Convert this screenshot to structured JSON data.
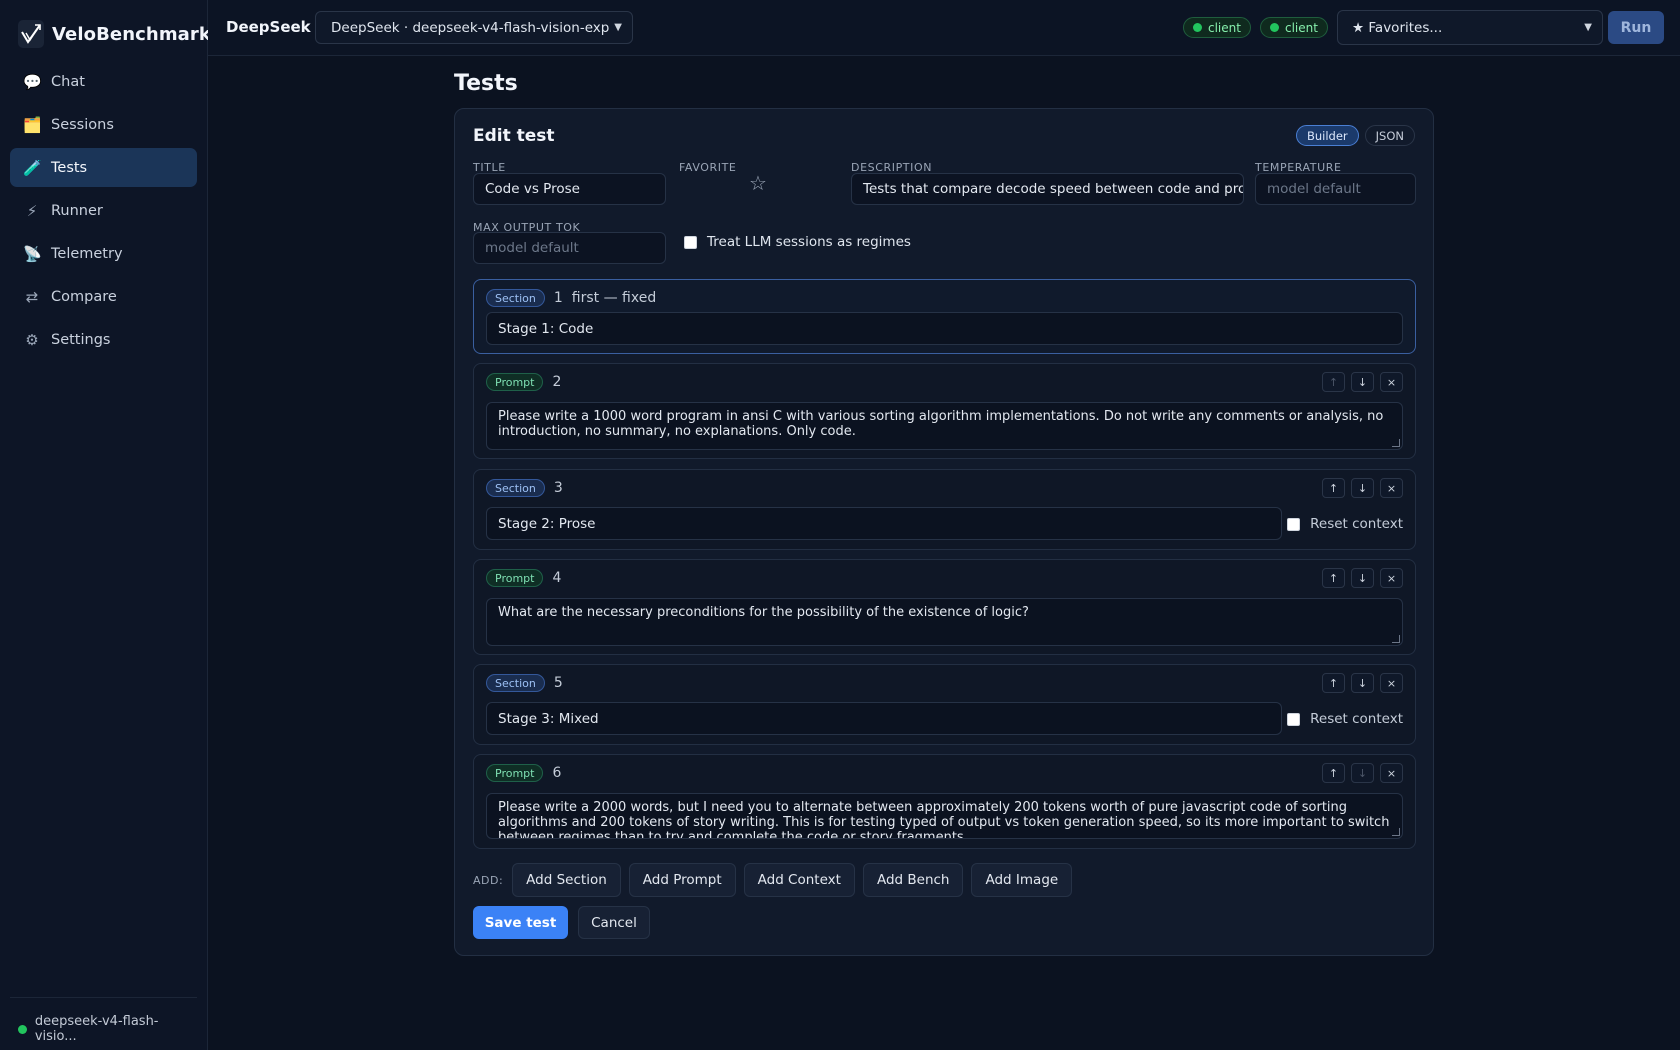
{
  "app": {
    "brand": "VeloBenchmark",
    "provider": "DeepSeek",
    "model_select": "DeepSeek · deepseek-v4-flash-vision-exp",
    "status_pills": [
      "client",
      "client"
    ],
    "favorites_select": "★ Favorites...",
    "run_label": "Run",
    "footer_model": "deepseek-v4-flash-visio..."
  },
  "sidebar": {
    "items": [
      {
        "label": "Chat",
        "icon": "💬"
      },
      {
        "label": "Sessions",
        "icon": "🗂️"
      },
      {
        "label": "Tests",
        "icon": "🧪"
      },
      {
        "label": "Runner",
        "icon": "⚡"
      },
      {
        "label": "Telemetry",
        "icon": "📡"
      },
      {
        "label": "Compare",
        "icon": "⇄"
      },
      {
        "label": "Settings",
        "icon": "⚙"
      }
    ],
    "active": "Tests"
  },
  "page": {
    "title": "Tests",
    "card_title": "Edit test",
    "modes": [
      "Builder",
      "JSON"
    ],
    "labels": {
      "title": "TITLE",
      "favorite": "FAVORITE",
      "description": "DESCRIPTION",
      "temperature": "TEMPERATURE",
      "max_output": "MAX OUTPUT TOK"
    },
    "values": {
      "title": "Code vs Prose",
      "description": "Tests that compare decode speed between code and prose",
      "temperature_placeholder": "model default",
      "max_output_placeholder": "model default"
    },
    "favorite_icon": "☆",
    "treat_llm_label": "Treat LLM sessions as regimes"
  },
  "blocks": [
    {
      "type": "Section",
      "index": "1",
      "note": "first — fixed",
      "value": "Stage 1: Code"
    },
    {
      "type": "Prompt",
      "index": "2",
      "value": "Please write a 1000 word program in ansi C with various sorting algorithm implementations. Do not write any comments or analysis, no introduction, no summary, no explanations. Only code."
    },
    {
      "type": "Section",
      "index": "3",
      "value": "Stage 2: Prose",
      "reset_label": "Reset context"
    },
    {
      "type": "Prompt",
      "index": "4",
      "value": "What are the necessary preconditions for the possibility of the existence of logic?"
    },
    {
      "type": "Section",
      "index": "5",
      "value": "Stage 3: Mixed",
      "reset_label": "Reset context"
    },
    {
      "type": "Prompt",
      "index": "6",
      "value": "Please write a 2000 words, but I need you to alternate between approximately 200 tokens worth of pure javascript code of sorting algorithms and 200 tokens of story writing. This is for testing typed of output vs token generation speed, so its more important to switch between regimes than to try and complete the code or story fragments."
    }
  ],
  "controls": {
    "up": "↑",
    "down": "↓",
    "close": "×"
  },
  "add": {
    "label": "ADD:",
    "buttons": [
      "Add Section",
      "Add Prompt",
      "Add Context",
      "Add Bench",
      "Add Image"
    ]
  },
  "actions": {
    "save": "Save test",
    "cancel": "Cancel"
  },
  "colors": {
    "accent": "#3b82f6",
    "status": "#22c55e"
  }
}
